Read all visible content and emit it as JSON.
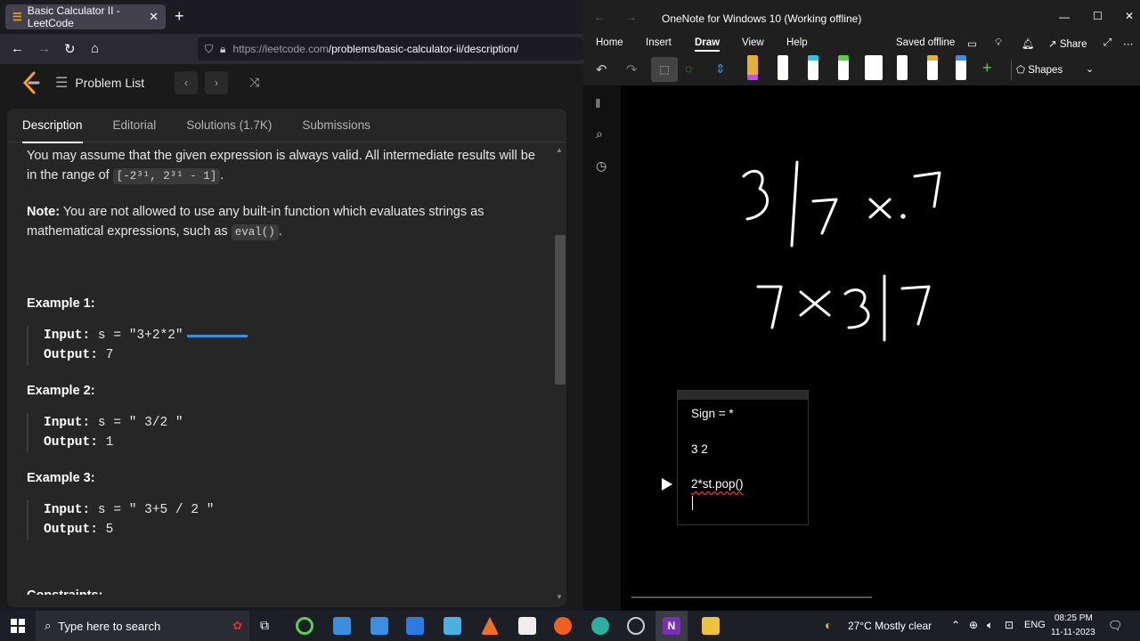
{
  "browser": {
    "tab_title": "Basic Calculator II - LeetCode",
    "url_host": "https://leetcode.com",
    "url_path": "/problems/basic-calculator-ii/description/",
    "problem_list": "Problem List",
    "tabs": [
      "Description",
      "Editorial",
      "Solutions (1.7K)",
      "Submissions"
    ],
    "para1_a": "You may assume that the given expression is always valid. All intermediate results will be in the range of ",
    "para1_code": "[-2³¹, 2³¹ - 1]",
    "para1_b": ".",
    "note_label": "Note:",
    "note_text": " You are not allowed to use any built-in function which evaluates strings as mathematical expressions, such as ",
    "note_code": "eval()",
    "note_end": ".",
    "examples": [
      {
        "title": "Example 1:",
        "input_label": "Input:",
        "input": " s = \"3+2*2\"",
        "output_label": "Output:",
        "output": " 7"
      },
      {
        "title": "Example 2:",
        "input_label": "Input:",
        "input": " s = \" 3/2 \"",
        "output_label": "Output:",
        "output": " 1"
      },
      {
        "title": "Example 3:",
        "input_label": "Input:",
        "input": " s = \" 3+5 / 2 \"",
        "output_label": "Output:",
        "output": " 5"
      }
    ],
    "cut_heading": "Constraints:"
  },
  "onenote": {
    "title": "OneNote for Windows 10 (Working offline)",
    "ribbon_tabs": [
      "Home",
      "Insert",
      "Draw",
      "View",
      "Help"
    ],
    "saved": "Saved offline",
    "share": "Share",
    "shapes": "Shapes",
    "notes": [
      "Sign = *",
      "3 2",
      "2*st.pop()"
    ]
  },
  "taskbar": {
    "search_placeholder": "Type here to search",
    "weather": "27°C  Mostly clear",
    "lang": "ENG",
    "time": "08:25 PM",
    "date": "11-11-2023"
  },
  "colors": {
    "accent_blue": "#3c8fe0",
    "pen_colors": [
      "#c050f0",
      "#ffffff",
      "#2ec3e0",
      "#5ad04a",
      "#ffffff",
      "#ffffff",
      "#e8b030",
      "#3c8fe0"
    ]
  }
}
